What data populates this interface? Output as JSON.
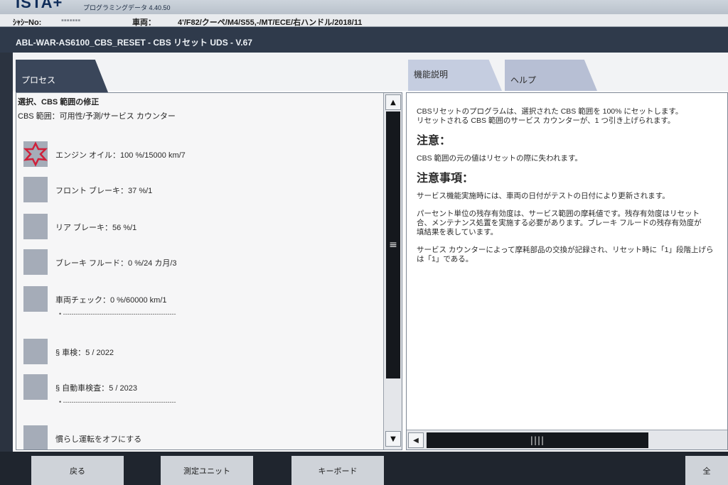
{
  "app": {
    "logo": "ISTA+",
    "version": "プログラミングデータ 4.40.50"
  },
  "vehicle_bar": {
    "chassis_label": "ｼｬｼｰNo:",
    "chassis_value": "▪▪▪▪▪▪▪",
    "vehicle_label": "車両：",
    "vehicle_value": "4'/F82/クーペ/M4/S55,-/MT/ECE/右ハンドル/2018/11"
  },
  "title": "ABL-WAR-AS6100_CBS_RESET - CBS リセット UDS - V.67",
  "tabs": {
    "process": "プロセス",
    "function_description": "機能説明",
    "help": "ヘルプ"
  },
  "left_panel": {
    "section_title": "選択、CBS 範囲の修正",
    "section_sub": "CBS 範囲：可用性/予測/サービス カウンター",
    "items": [
      {
        "label": "エンジン オイル：100 %/15000 km/7",
        "dots": ""
      },
      {
        "label": "フロント ブレーキ：37 %/1",
        "dots": ""
      },
      {
        "label": "リア ブレーキ：56 %/1",
        "dots": ""
      },
      {
        "label": "ブレーキ フルード：0 %/24 カ月/3",
        "dots": ""
      },
      {
        "label": "車両チェック：0 %/60000 km/1",
        "dots": "•  -----------------------------------------------------"
      },
      {
        "label": "§ 車検：5 / 2022",
        "dots": ""
      },
      {
        "label": "§ 自動車検査：5 / 2023",
        "dots": "•  -----------------------------------------------------"
      },
      {
        "label": "慣らし運転をオフにする",
        "dots": ""
      }
    ]
  },
  "right_panel": {
    "intro1": "CBSリセットのプログラムは、選択された CBS 範囲を 100% にセットします。",
    "intro2": "リセットされる CBS 範囲のサービス カウンターが、1 つ引き上げられます。",
    "note_heading": "注意：",
    "note_text": "CBS 範囲の元の値はリセットの際に失われます。",
    "notes_heading": "注意事項：",
    "p1": "サービス機能実施時には、車両の日付がテストの日付により更新されます。",
    "p2a": "パーセント単位の残存有効度は、サービス範囲の摩耗値です。残存有効度はリセット",
    "p2b": "合、メンテナンス処置を実施する必要があります。ブレーキ フルードの残存有効度が",
    "p2c": "填結果を表しています。",
    "p3a": "サービス カウンターによって摩耗部品の交換が記録され、リセット時に「1」段階上げら",
    "p3b": "は「1」である。"
  },
  "bottom": {
    "back": "戻る",
    "measuring_unit": "測定ユニット",
    "keyboard": "キーボード",
    "fullscreen": "全"
  },
  "colors": {
    "warning_star": "#d0203a",
    "status_box": "#a5acb8",
    "title_bar": "#2f3a4b"
  }
}
